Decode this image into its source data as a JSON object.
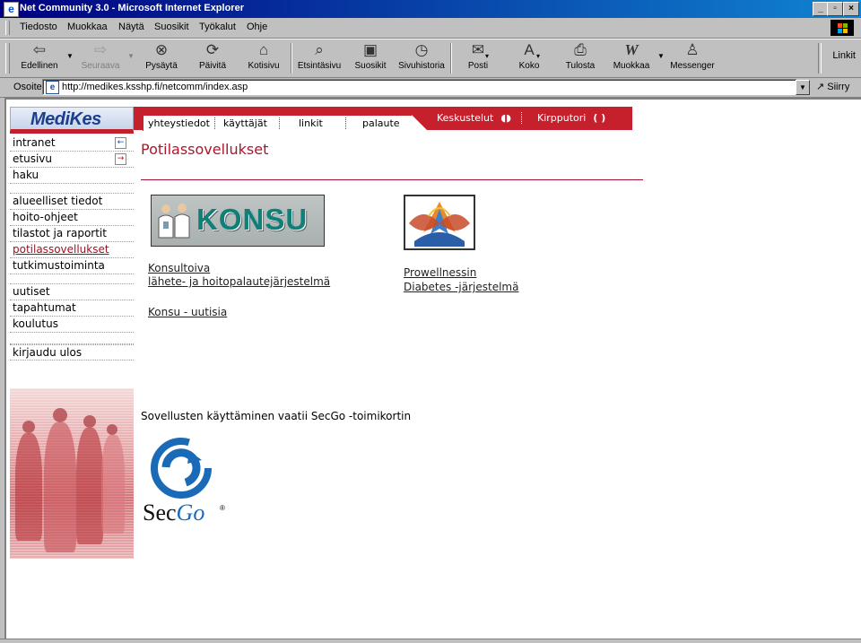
{
  "window": {
    "title": "Net Community 3.0 - Microsoft Internet Explorer",
    "controls": [
      "_",
      "▫",
      "×"
    ]
  },
  "menu": [
    "Tiedosto",
    "Muokkaa",
    "Näytä",
    "Suosikit",
    "Työkalut",
    "Ohje"
  ],
  "toolbar": {
    "back": "Edellinen",
    "forward": "Seuraava",
    "stop": "Pysäytä",
    "refresh": "Päivitä",
    "home": "Kotisivu",
    "search": "Etsintäsivu",
    "favorites": "Suosikit",
    "history": "Sivuhistoria",
    "mail": "Posti",
    "size": "Koko",
    "print": "Tulosta",
    "edit": "Muokkaa",
    "messenger": "Messenger",
    "links": "Linkit"
  },
  "address": {
    "label": "Osoite",
    "url": "http://medikes.ksshp.fi/netcomm/index.asp",
    "go": "Siirry"
  },
  "site": {
    "brand": "MediKes",
    "tabs": [
      "yhteystiedot",
      "käyttäjät",
      "linkit",
      "palaute"
    ],
    "right_tabs": [
      "Keskustelut",
      "Kirpputori"
    ],
    "sidebar_group1": [
      "intranet",
      "etusivu",
      "haku"
    ],
    "sidebar_group2": [
      "alueelliset tiedot",
      "hoito-ohjeet",
      "tilastot ja raportit",
      "potilassovellukset",
      "tutkimustoiminta"
    ],
    "sidebar_group3": [
      "uutiset",
      "tapahtumat",
      "koulutus"
    ],
    "sidebar_logout": "kirjaudu ulos"
  },
  "content": {
    "title": "Potilassovellukset",
    "konsu_banner": "KONSU",
    "konsu_link1": "Konsultoiva",
    "konsu_link2": "lähete- ja hoitopalautejärjestelmä",
    "konsu_news": "Konsu - uutisia",
    "prow_link1": "Prowellnessin",
    "prow_link2": "Diabetes -järjestelmä",
    "secgo_notice": "Sovellusten käyttäminen vaatii SecGo -toimikortin",
    "secgo_logo_a": "Sec",
    "secgo_logo_b": "Go",
    "secgo_reg": "®"
  },
  "colors": {
    "accent_red": "#c5202c",
    "brand_blue": "#1b3f8f",
    "title_red": "#b0142a"
  }
}
